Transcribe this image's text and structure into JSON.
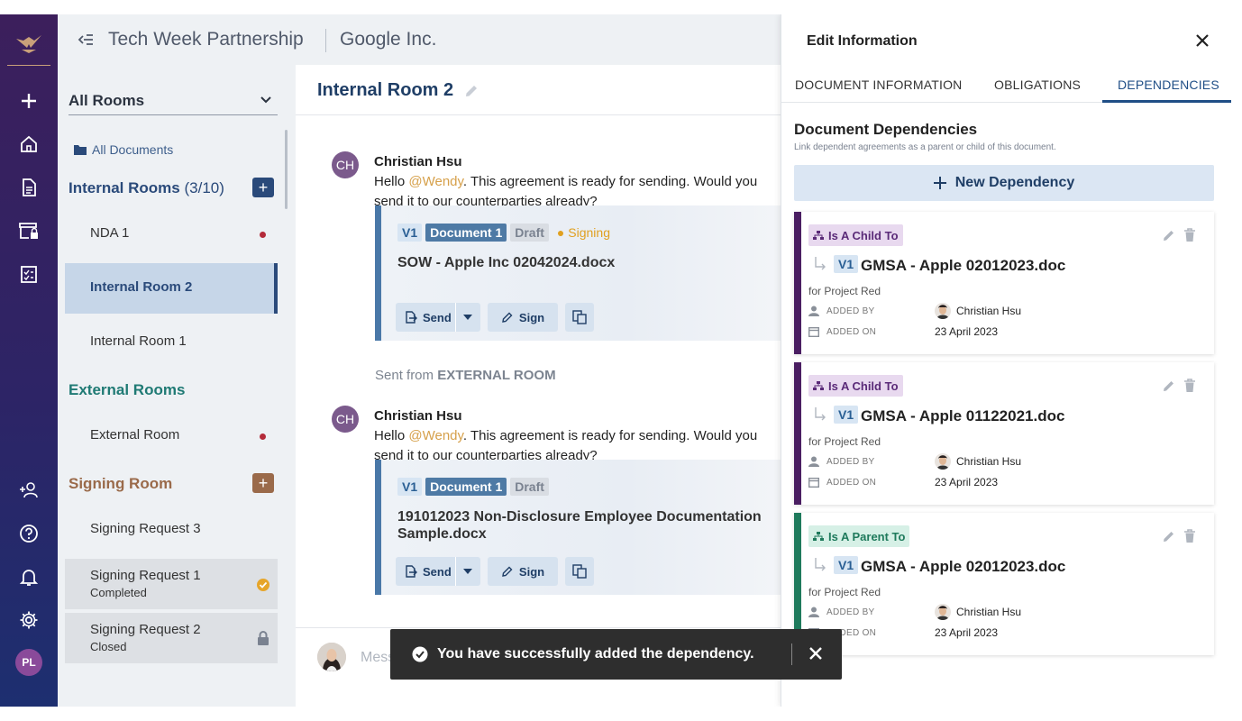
{
  "header": {
    "title": "Tech Week Partnership",
    "company": "Google Inc."
  },
  "rooms": {
    "selector": "All Rooms",
    "all_documents": "All Documents",
    "internal": {
      "label": "Internal Rooms",
      "count": "(3/10)",
      "items": [
        "NDA 1",
        "Internal Room 2",
        "Internal Room 1"
      ]
    },
    "external": {
      "label": "External Rooms",
      "items": [
        "External Room"
      ]
    },
    "signing": {
      "label": "Signing Room",
      "items": [
        {
          "label": "Signing Request 3",
          "sub": ""
        },
        {
          "label": "Signing Request 1",
          "sub": "Completed"
        },
        {
          "label": "Signing Request 2",
          "sub": "Closed"
        }
      ]
    }
  },
  "chat": {
    "title": "Internal Room 2",
    "messages": [
      {
        "initials": "CH",
        "author": "Christian Hsu",
        "text_pre": "Hello ",
        "mention": "@Wendy",
        "text_post": ". This agreement is ready for sending. Would you send it to our counterparties already?",
        "version": "V1",
        "doc_label": "Document 1",
        "status": "Draft",
        "signing": "Signing",
        "file": "SOW - Apple Inc 02042024.docx"
      },
      {
        "initials": "CH",
        "author": "Christian Hsu",
        "text_pre": "Hello ",
        "mention": "@Wendy",
        "text_post": ". This agreement is ready for sending. Would you send it to our counterparties already?",
        "version": "V1",
        "doc_label": "Document 1",
        "status": "Draft",
        "file": "191012023 Non-Disclosure Employee Documentation Sample.docx"
      }
    ],
    "sent_from_prefix": "Sent from ",
    "sent_from_room": "EXTERNAL ROOM",
    "send_label": "Send",
    "sign_label": "Sign",
    "composer_placeholder": "Message"
  },
  "panel": {
    "title": "Edit Information",
    "tabs": [
      "DOCUMENT INFORMATION",
      "OBLIGATIONS",
      "DEPENDENCIES"
    ],
    "active_tab": "DEPENDENCIES",
    "section_title": "Document Dependencies",
    "section_sub": "Link dependent agreements as a parent or child of this document.",
    "new_button": "New Dependency",
    "added_by_label": "ADDED BY",
    "added_on_label": "ADDED ON",
    "dependencies": [
      {
        "relation": "Is A Child To",
        "version": "V1",
        "name": "GMSA - Apple 02012023.doc",
        "project": "for Project Red",
        "added_by": "Christian Hsu",
        "added_on": "23 April 2023"
      },
      {
        "relation": "Is A Child To",
        "version": "V1",
        "name": "GMSA - Apple 01122021.doc",
        "project": "for Project Red",
        "added_by": "Christian Hsu",
        "added_on": "23 April 2023"
      },
      {
        "relation": "Is A Parent To",
        "version": "V1",
        "name": "GMSA - Apple 02012023.doc",
        "project": "for Project Red",
        "added_by": "Christian Hsu",
        "added_on": "23 April 2023"
      }
    ]
  },
  "toast": {
    "message": "You have successfully added the dependency."
  },
  "user": {
    "initials": "PL"
  },
  "colors": {
    "rail_top": "#3c1f5c",
    "rail_bottom": "#1d2f70",
    "internal": "#2a4a7a",
    "external": "#1f7a74",
    "signing": "#9a6a4a",
    "child": "#4a1e62",
    "parent": "#1f7a5c"
  }
}
